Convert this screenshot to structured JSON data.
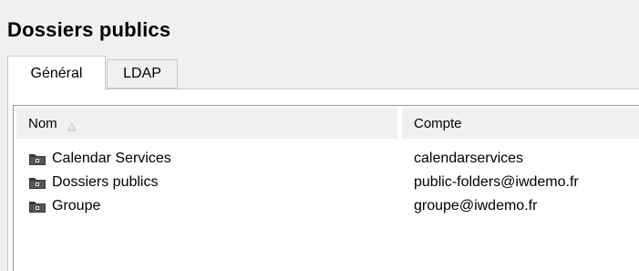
{
  "window": {
    "title": "Dossiers publics"
  },
  "tabs": [
    {
      "label": "Général",
      "selected": true
    },
    {
      "label": "LDAP",
      "selected": false
    }
  ],
  "list": {
    "columns": [
      {
        "label": "Nom",
        "sorted": "ascending"
      },
      {
        "label": "Compte"
      }
    ],
    "sort_indicator": "△",
    "rows": [
      {
        "icon": "public-folder-icon",
        "nom": "Calendar Services",
        "compte": "calendarservices"
      },
      {
        "icon": "public-folder-icon",
        "nom": "Dossiers publics",
        "compte": "public-folders@iwdemo.fr"
      },
      {
        "icon": "public-folder-icon",
        "nom": "Groupe",
        "compte": "groupe@iwdemo.fr"
      }
    ]
  },
  "colors": {
    "window_bg": "#f0f0f0",
    "panel_bg": "#ffffff",
    "header_bg": "#f0f0f0",
    "folder_icon": "#3a3a3a"
  }
}
